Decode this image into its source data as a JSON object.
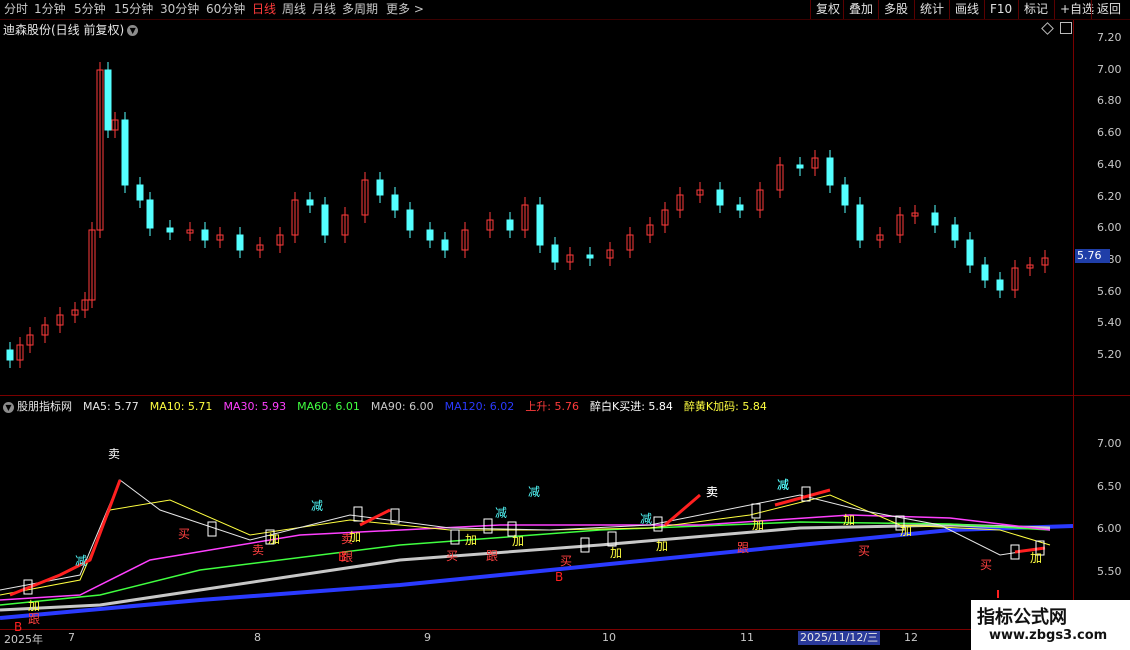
{
  "toolbar": {
    "period_tabs": [
      "分时",
      "1分钟",
      "5分钟",
      "15分钟",
      "30分钟",
      "60分钟",
      "日线",
      "周线",
      "月线",
      "多周期",
      "更多 >"
    ],
    "right_buttons": [
      "复权",
      "叠加",
      "多股",
      "统计",
      "画线",
      "F10",
      "标记",
      "+自选",
      "返回"
    ]
  },
  "price_panel": {
    "title": "迪森股份(日线 前复权)",
    "current_price": "5.76",
    "y_ticks": [
      "7.20",
      "7.00",
      "6.80",
      "6.60",
      "6.40",
      "6.20",
      "6.00",
      "5.80",
      "5.60",
      "5.40",
      "5.20"
    ]
  },
  "indicator_panel": {
    "title": "股朋指标网",
    "legend": [
      {
        "label": "MA5: 5.77",
        "color": "#e6e6e6"
      },
      {
        "label": "MA10: 5.71",
        "color": "#ffff40"
      },
      {
        "label": "MA30: 5.93",
        "color": "#ff40ff"
      },
      {
        "label": "MA60: 6.01",
        "color": "#40ff40"
      },
      {
        "label": "MA90: 6.00",
        "color": "#c8c8c8"
      },
      {
        "label": "MA120: 6.02",
        "color": "#2a3aff"
      },
      {
        "label": "上升: 5.76",
        "color": "#ff3b3b"
      },
      {
        "label": "醉白K买进: 5.84",
        "color": "#ffffff"
      },
      {
        "label": "醉黄K加码: 5.84",
        "color": "#ffff40"
      }
    ],
    "y_ticks": [
      "7.00",
      "6.50",
      "6.00",
      "5.50"
    ]
  },
  "signals": [
    "卖",
    "减",
    "B",
    "跟",
    "加",
    "买",
    "卖",
    "减",
    "卖",
    "B",
    "跟",
    "减",
    "加",
    "买",
    "减",
    "卖",
    "减",
    "加",
    "加",
    "跟",
    "加",
    "加",
    "买",
    "加",
    "B",
    "加",
    "减",
    "卖",
    "减",
    "加",
    "跟",
    "买",
    "加",
    "买",
    "加"
  ],
  "x_axis": {
    "labels": [
      "2025年",
      "7",
      "8",
      "9",
      "10",
      "11",
      "12"
    ],
    "current_date": "2025/11/12/三"
  },
  "watermark": {
    "line1": "指标公式网",
    "line2": "www.zbgs3.com"
  },
  "colors": {
    "up": "#ff3b3b",
    "down": "#54ffff",
    "bg": "#000000",
    "axis": "#7a0000",
    "price_tag": "#1f3ea8"
  }
}
